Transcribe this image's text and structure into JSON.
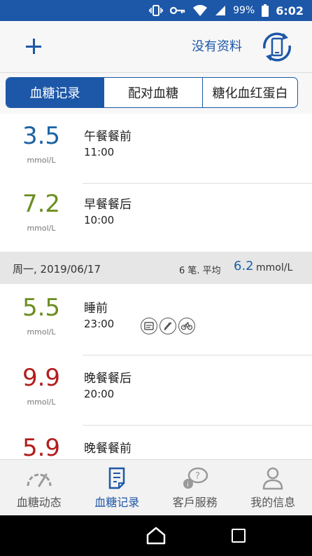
{
  "status_bar": {
    "battery": "99%",
    "time": "6:02"
  },
  "header": {
    "no_data_label": "没有资料"
  },
  "tabs": [
    {
      "label": "血糖记录",
      "active": true
    },
    {
      "label": "配对血糖",
      "active": false
    },
    {
      "label": "糖化血红蛋白",
      "active": false
    }
  ],
  "records": [
    {
      "value": "3.5",
      "unit": "mmol/L",
      "meal": "午餐餐前",
      "time": "11:00",
      "color": "#1b63a6"
    },
    {
      "value": "7.2",
      "unit": "mmol/L",
      "meal": "早餐餐后",
      "time": "10:00",
      "color": "#6b8e1f"
    },
    {
      "value": "5.5",
      "unit": "mmol/L",
      "meal": "睡前",
      "time": "23:00",
      "color": "#6b8e1f"
    },
    {
      "value": "9.9",
      "unit": "mmol/L",
      "meal": "晚餐餐后",
      "time": "20:00",
      "color": "#b41c1c"
    },
    {
      "value": "5.9",
      "meal": "晚餐餐前",
      "color": "#b41c1c"
    }
  ],
  "date_header": {
    "date": "周一, 2019/06/17",
    "count": "6 笔. 平均",
    "avg": "6.2",
    "avg_unit": "mmol/L"
  },
  "record_tags": [
    "notes-icon",
    "grain-icon",
    "bike-icon"
  ],
  "nav": [
    {
      "label": "血糖动态",
      "icon": "gauge-icon",
      "active": false
    },
    {
      "label": "血糖记录",
      "icon": "logbook-icon",
      "active": true
    },
    {
      "label": "客戶服務",
      "icon": "chat-help-icon",
      "active": false
    },
    {
      "label": "我的信息",
      "icon": "person-icon",
      "active": false
    }
  ],
  "colors": {
    "brand": "#1d57a8",
    "low": "#1b63a6",
    "normal": "#6b8e1f",
    "high": "#b41c1c"
  }
}
